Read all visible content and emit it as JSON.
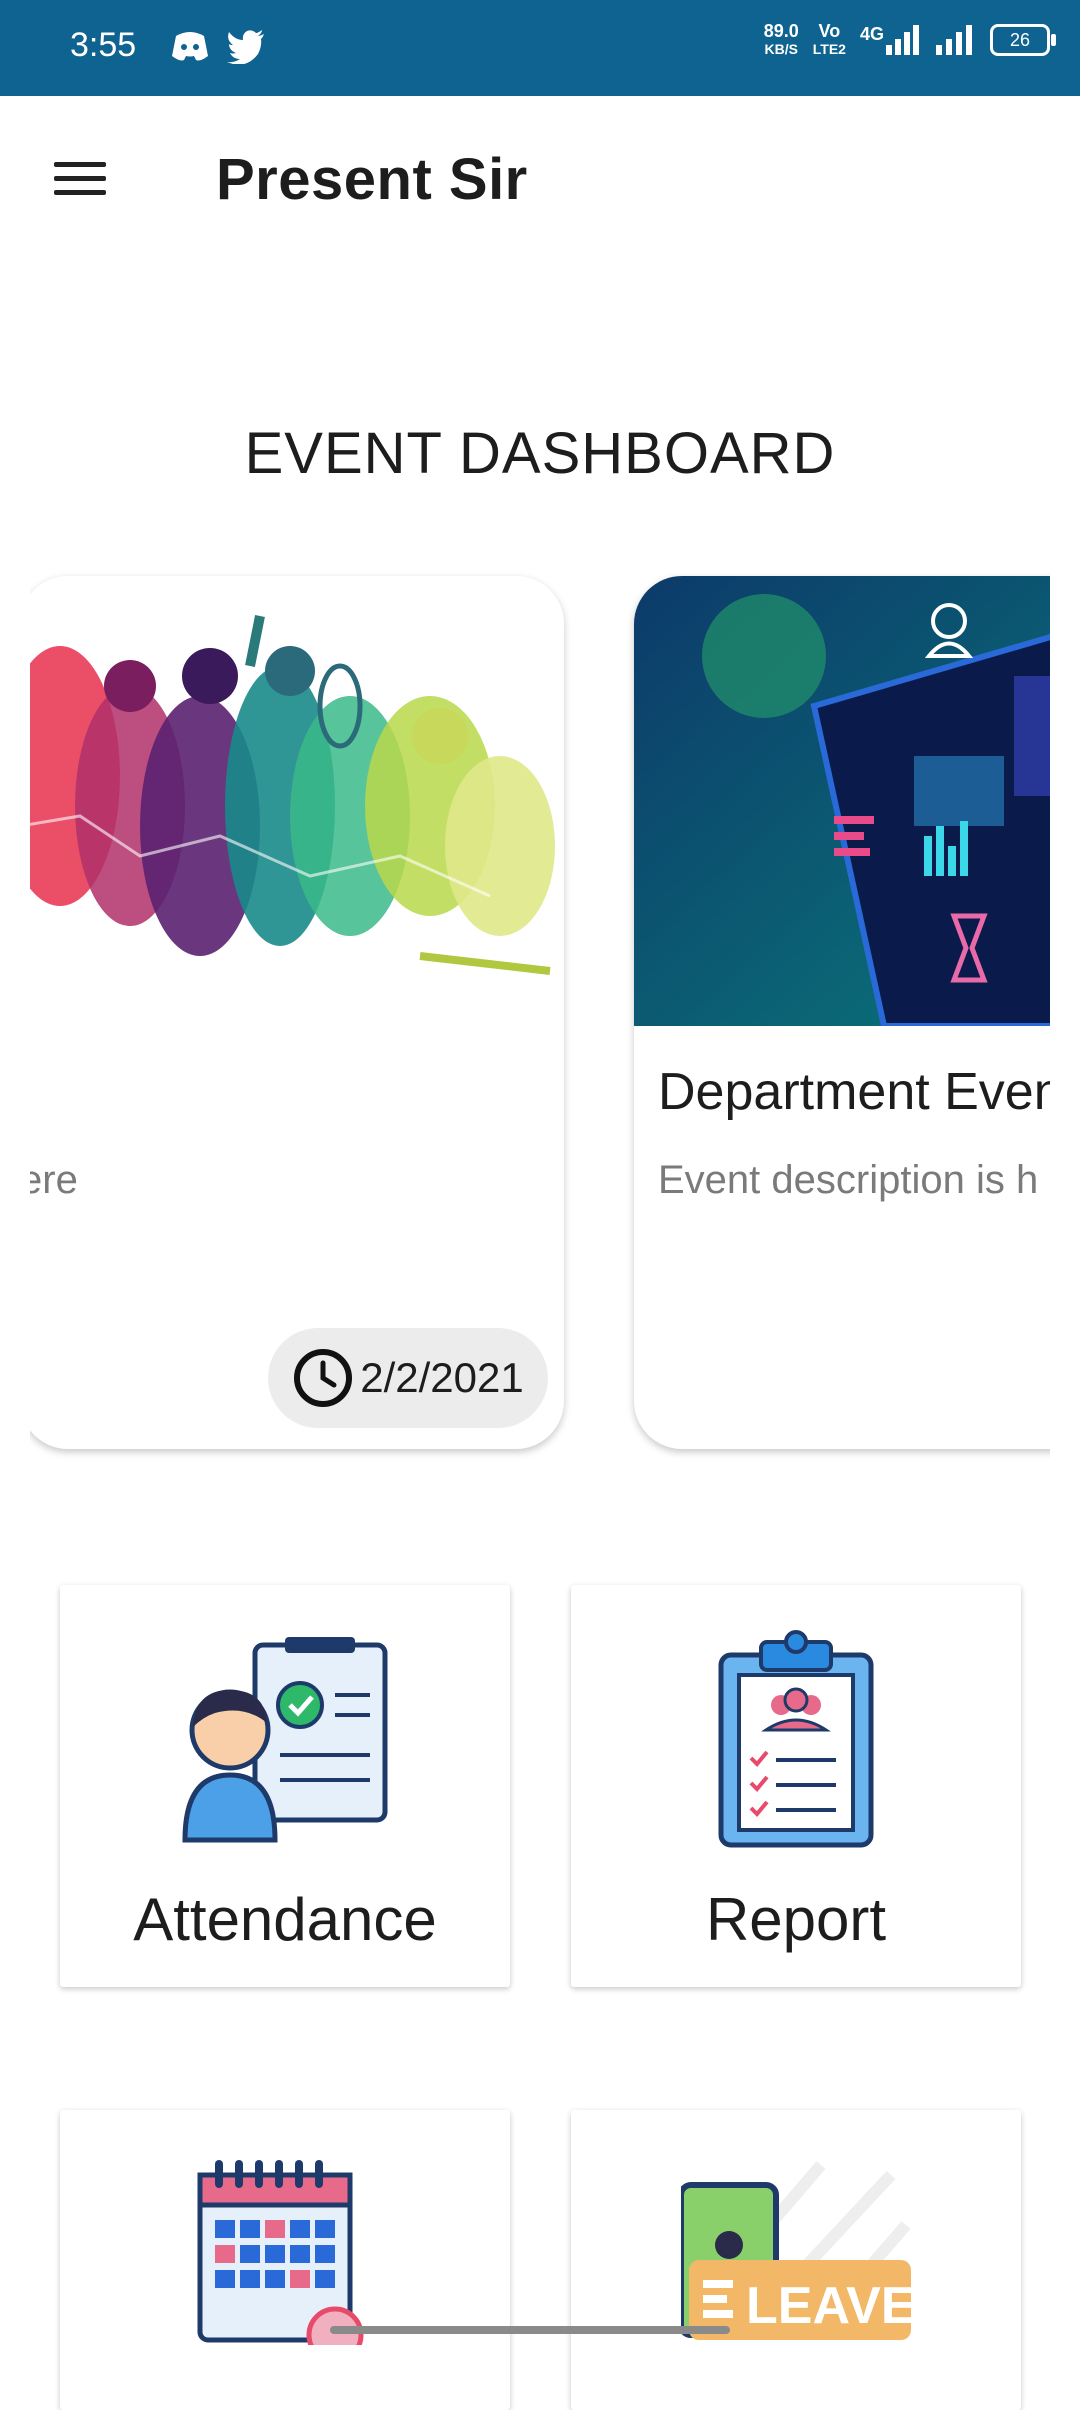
{
  "status_bar": {
    "time": "3:55",
    "speed": "89.0",
    "speed_unit": "KB/S",
    "volte_top": "Vo",
    "volte_bottom": "LTE2",
    "network": "4G",
    "battery": "26",
    "icons": [
      "discord-icon",
      "twitter-icon",
      "signal-icon",
      "signal-icon",
      "battery-icon"
    ]
  },
  "app_bar": {
    "title": "Present Sir",
    "menu_icon": "hamburger-menu-icon"
  },
  "dashboard": {
    "title": "EVENT DASHBOARD"
  },
  "events": [
    {
      "title": "",
      "description": "ere",
      "date": "2/2/2021",
      "image": "sports-silhouettes"
    },
    {
      "title": "Department Even",
      "description": "Event description is h",
      "image": "tech-dashboard"
    }
  ],
  "tiles": [
    {
      "label": "Attendance",
      "icon": "attendance-icon"
    },
    {
      "label": "Report",
      "icon": "report-clipboard-icon"
    },
    {
      "label": "",
      "icon": "calendar-icon"
    },
    {
      "label": "LEAVE",
      "icon": "leave-icon"
    }
  ]
}
